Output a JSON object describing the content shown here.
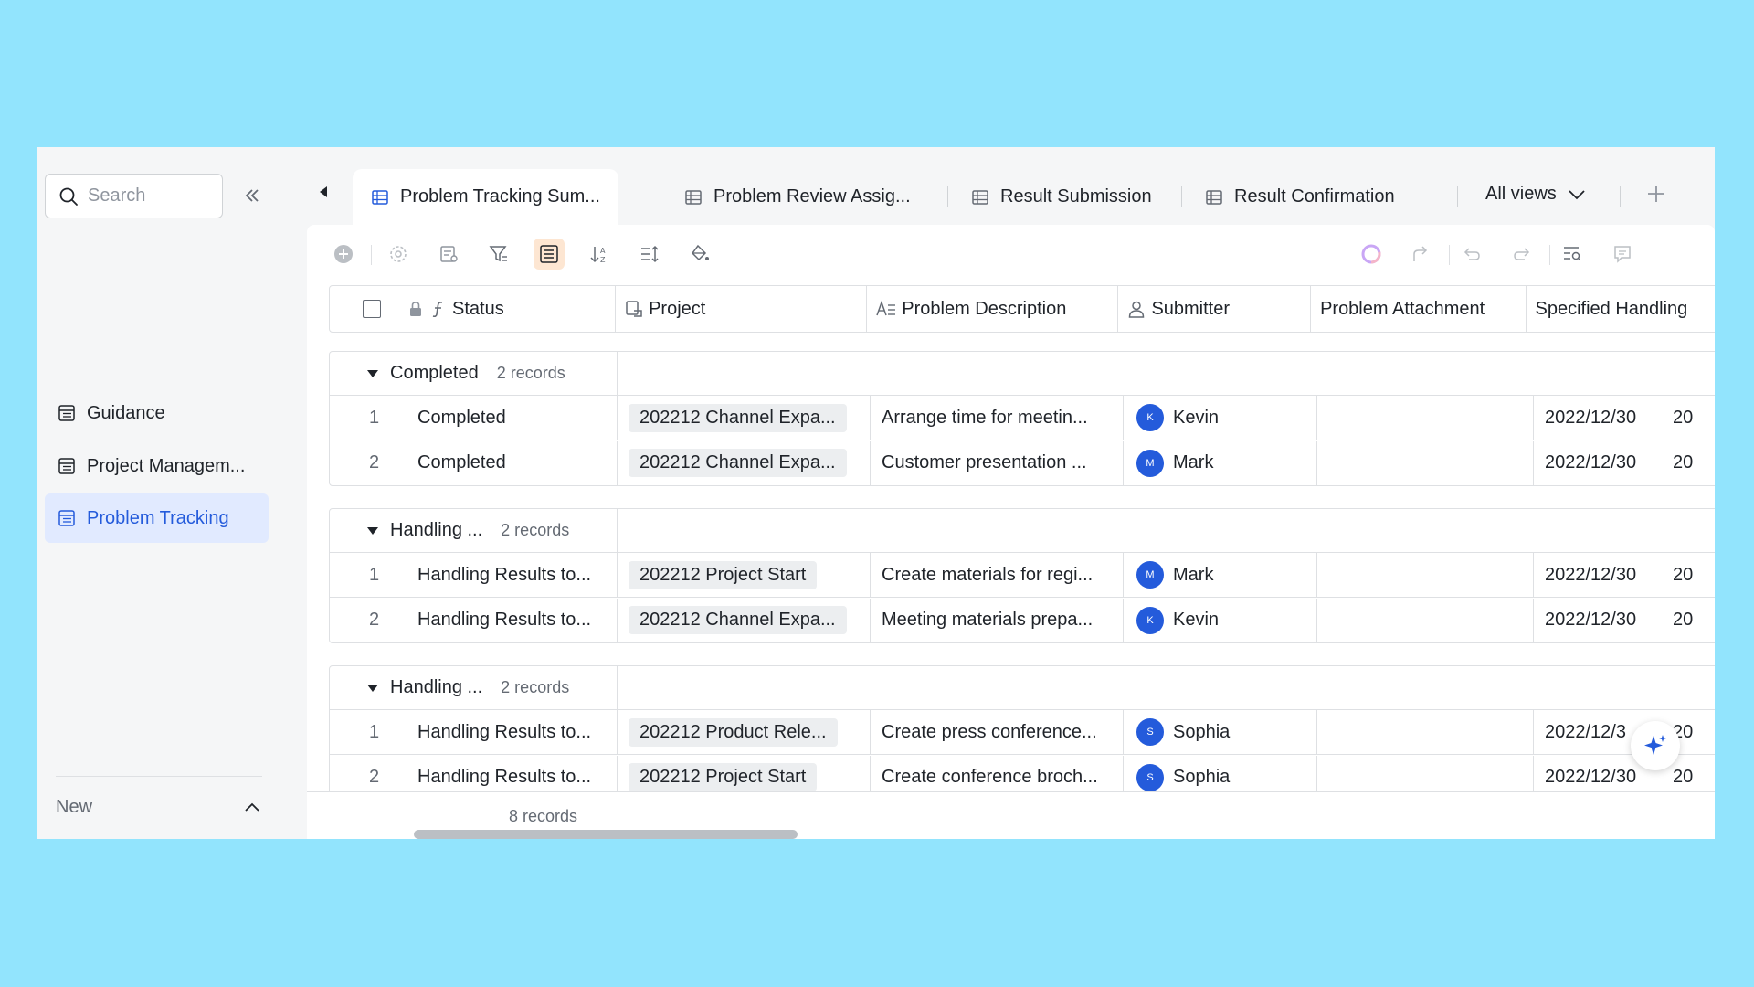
{
  "sidebar": {
    "search_placeholder": "Search",
    "items": [
      {
        "label": "Guidance",
        "active": false
      },
      {
        "label": "Project Managem...",
        "active": false
      },
      {
        "label": "Problem Tracking",
        "active": true
      }
    ],
    "new_label": "New"
  },
  "tabs": [
    {
      "label": "Problem Tracking Sum...",
      "active": true
    },
    {
      "label": "Problem Review Assig...",
      "active": false
    },
    {
      "label": "Result Submission",
      "active": false
    },
    {
      "label": "Result Confirmation",
      "active": false
    }
  ],
  "all_views_label": "All views",
  "columns": {
    "status": "Status",
    "project": "Project",
    "description": "Problem Description",
    "submitter": "Submitter",
    "attachment": "Problem Attachment",
    "handling": "Specified Handling"
  },
  "groups": [
    {
      "name": "Completed",
      "count": "2 records",
      "rows": [
        {
          "idx": "1",
          "status": "Completed",
          "project": "202212 Channel Expa...",
          "description": "Arrange time for meetin...",
          "submitter": "Kevin",
          "avatar": "K",
          "date": "2022/12/30",
          "date2": "20"
        },
        {
          "idx": "2",
          "status": "Completed",
          "project": "202212 Channel Expa...",
          "description": "Customer presentation ...",
          "submitter": "Mark",
          "avatar": "M",
          "date": "2022/12/30",
          "date2": "20"
        }
      ]
    },
    {
      "name": "Handling ...",
      "count": "2 records",
      "rows": [
        {
          "idx": "1",
          "status": "Handling Results to...",
          "project": "202212 Project Start",
          "description": "Create materials for regi...",
          "submitter": "Mark",
          "avatar": "M",
          "date": "2022/12/30",
          "date2": "20"
        },
        {
          "idx": "2",
          "status": "Handling Results to...",
          "project": "202212 Channel Expa...",
          "description": "Meeting materials prepa...",
          "submitter": "Kevin",
          "avatar": "K",
          "date": "2022/12/30",
          "date2": "20"
        }
      ]
    },
    {
      "name": "Handling ...",
      "count": "2 records",
      "rows": [
        {
          "idx": "1",
          "status": "Handling Results to...",
          "project": "202212 Product Rele...",
          "description": "Create press conference...",
          "submitter": "Sophia",
          "avatar": "S",
          "date": "2022/12/3",
          "date2": "20"
        },
        {
          "idx": "2",
          "status": "Handling Results to...",
          "project": "202212 Project Start",
          "description": "Create conference broch...",
          "submitter": "Sophia",
          "avatar": "S",
          "date": "2022/12/30",
          "date2": "20"
        }
      ]
    }
  ],
  "footer_count": "8 records",
  "colors": {
    "accent": "#245bdb",
    "background": "#92e4fd",
    "active_nav_bg": "#e1eaff",
    "active_tool_bg": "#fde6d2"
  }
}
